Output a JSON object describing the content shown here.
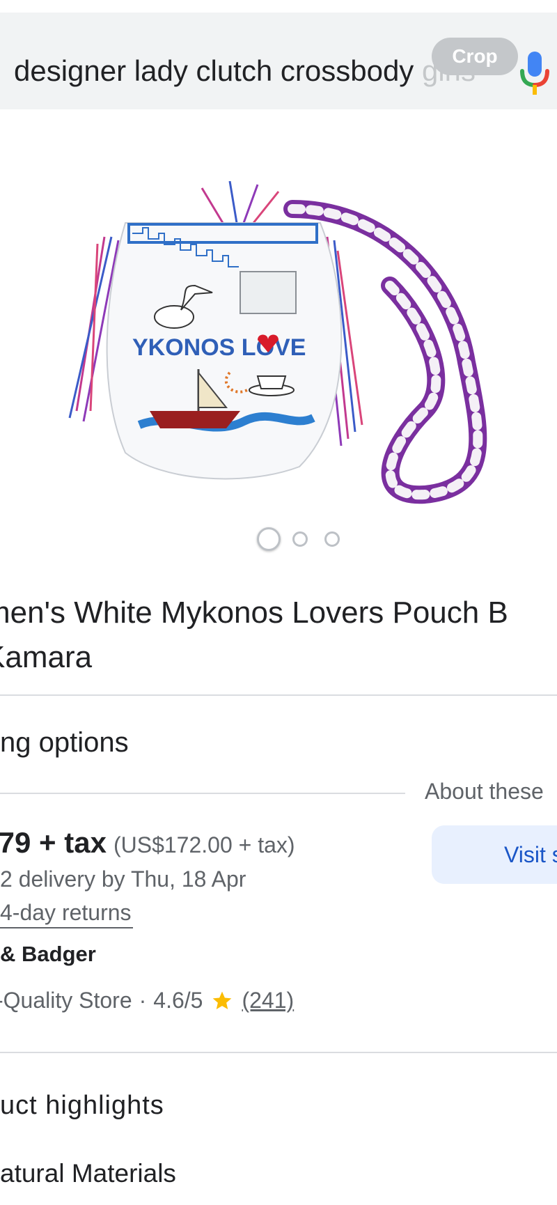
{
  "search": {
    "query_visible": "designer lady clutch crossbody ",
    "query_faded": "girls",
    "crop_label": "Crop"
  },
  "icons": {
    "mic": "microphone-icon",
    "star": "star-icon"
  },
  "colors": {
    "search_bg": "#f1f3f4",
    "visit_bg": "#e8f0fe",
    "visit_text": "#1a56c7",
    "star": "#fbbc04",
    "mic_blue": "#4285f4",
    "mic_red": "#ea4335",
    "mic_yellow": "#fbbc04",
    "mic_green": "#34a853"
  },
  "image": {
    "embroidery_text": "YKONOS LOVE",
    "carousel": {
      "count": 3,
      "active": 1
    }
  },
  "product": {
    "title_line1": "men's White Mykonos Lovers Pouch B",
    "title_line2": " Kamara"
  },
  "shopping": {
    "section_title": "ng options",
    "about_label": "About these",
    "visit_label": "Visit s",
    "price_main": ".79 + tax",
    "price_alt": "(US$172.00 + tax)",
    "delivery": "2 delivery by Thu, 18 Apr",
    "returns": "4-day returns",
    "seller_name": "& Badger",
    "store_type": "-Quality Store",
    "separator": "·",
    "rating": "4.6/5",
    "review_count": "(241)"
  },
  "highlights": {
    "section_title": "uct highlights",
    "item1": "atural Materials"
  }
}
